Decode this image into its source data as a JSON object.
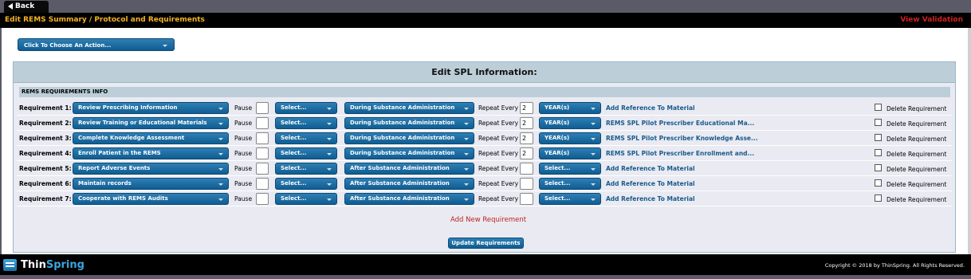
{
  "nav": {
    "back_label": "Back"
  },
  "header": {
    "breadcrumb": "Edit REMS Summary  /  Protocol and Requirements",
    "view_validation": "View Validation"
  },
  "actions": {
    "choose_label": "Click To Choose An Action..."
  },
  "panel": {
    "title": "Edit SPL Information:",
    "section_label": "REMS REQUIREMENTS INFO",
    "pause_label": "Pause",
    "repeat_label": "Repeat Every",
    "delete_label": "Delete Requirement",
    "add_new": "Add New Requirement",
    "update_button": "Update Requirements"
  },
  "requirements": [
    {
      "label": "Requirement 1:",
      "task": "Review Prescribing Information",
      "select": "Select...",
      "when": "During Substance Administration",
      "repeat": "2",
      "period": "YEAR(s)",
      "reference": "Add Reference To Material"
    },
    {
      "label": "Requirement 2:",
      "task": "Review Training or Educational Materials",
      "select": "Select...",
      "when": "During Substance Administration",
      "repeat": "2",
      "period": "YEAR(s)",
      "reference": "REMS SPL Pilot Prescriber Educational Ma..."
    },
    {
      "label": "Requirement 3:",
      "task": "Complete Knowledge Assessment",
      "select": "Select...",
      "when": "During Substance Administration",
      "repeat": "2",
      "period": "YEAR(s)",
      "reference": "REMS SPL Pilot Prescriber Knowledge Asse..."
    },
    {
      "label": "Requirement 4:",
      "task": "Enroll Patient in the REMS",
      "select": "Select...",
      "when": "During Substance Administration",
      "repeat": "2",
      "period": "YEAR(s)",
      "reference": "REMS SPL Pilot Prescriber Enrollment and..."
    },
    {
      "label": "Requirement 5:",
      "task": "Report Adverse Events",
      "select": "Select...",
      "when": "After Substance Administration",
      "repeat": "",
      "period": "Select...",
      "reference": "Add Reference To Material"
    },
    {
      "label": "Requirement 6:",
      "task": "Maintain records",
      "select": "Select...",
      "when": "After Substance Administration",
      "repeat": "",
      "period": "Select...",
      "reference": "Add Reference To Material"
    },
    {
      "label": "Requirement 7:",
      "task": "Cooperate with REMS Audits",
      "select": "Select...",
      "when": "After Substance Administration",
      "repeat": "",
      "period": "Select...",
      "reference": "Add Reference To Material"
    }
  ],
  "footer": {
    "logo_part1": "Thin",
    "logo_part2": "Spring",
    "copyright": "Copyright © 2018 by ThinSpring. All Rights Reserved."
  },
  "colors": {
    "accent_blue": "#1a6fa5",
    "breadcrumb": "#f5b323",
    "validation": "#d0201f"
  }
}
